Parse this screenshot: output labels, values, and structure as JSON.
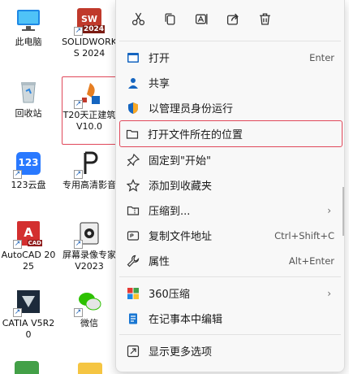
{
  "desktop": {
    "icons": [
      {
        "label": "此电脑"
      },
      {
        "label": "SOLIDWORKS 2024",
        "badge": "2024"
      },
      {
        "label": "回收站"
      },
      {
        "label": "T20天正建筑 V10.0"
      },
      {
        "label": "123云盘",
        "badge": "123"
      },
      {
        "label": "专用高清影音"
      },
      {
        "label": "AutoCAD 2025",
        "badge": "CAD"
      },
      {
        "label": "屏幕录像专家V2023"
      },
      {
        "label": "CATIA V5R20"
      },
      {
        "label": "微信"
      }
    ]
  },
  "menu": {
    "iconbar": [
      "cut-icon",
      "copy-icon",
      "rename-icon",
      "share-icon",
      "delete-icon"
    ],
    "items": [
      {
        "label": "打开",
        "shortcut": "Enter"
      },
      {
        "label": "共享"
      },
      {
        "label": "以管理员身份运行"
      },
      {
        "label": "打开文件所在的位置"
      },
      {
        "label": "固定到\"开始\""
      },
      {
        "label": "添加到收藏夹"
      },
      {
        "label": "压缩到..."
      },
      {
        "label": "复制文件地址",
        "shortcut": "Ctrl+Shift+C"
      },
      {
        "label": "属性",
        "shortcut": "Alt+Enter"
      },
      {
        "label": "360压缩"
      },
      {
        "label": "在记事本中编辑"
      },
      {
        "label": "显示更多选项"
      }
    ]
  },
  "colors": {
    "highlight": "#e0485a",
    "accent": "#1a5fb4"
  }
}
